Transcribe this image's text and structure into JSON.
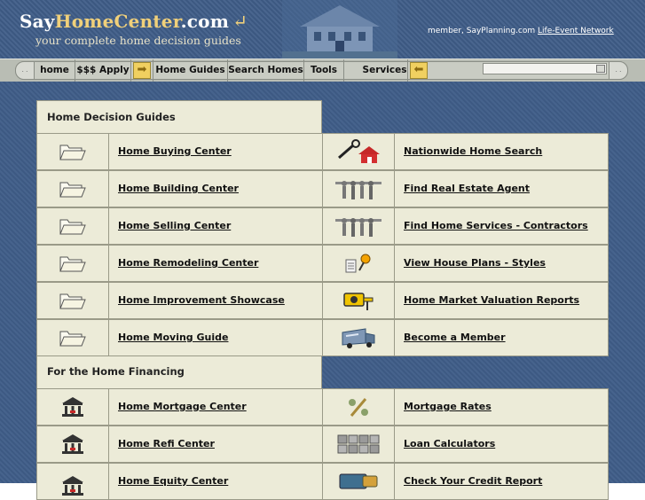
{
  "header": {
    "logo_say": "Say",
    "logo_home": "HomeCenter",
    "logo_com": ".com",
    "logo_arrow": "↵",
    "tagline": "your complete home decision guides",
    "member_prefix": "member, SayPlanning.com",
    "member_link": "Life-Event Network"
  },
  "nav": {
    "items": [
      "home",
      "$$$ Apply",
      "Home Guides",
      "Search Homes",
      "Tools",
      "Services"
    ],
    "arrow_right": "➡",
    "arrow_left": "⬅",
    "left_cap": ". .",
    "right_cap": ". ."
  },
  "sections": {
    "decision_title": "Home Decision Guides",
    "financing_title": "For the Home Financing"
  },
  "decision_rows": [
    {
      "left": "Home Buying Center",
      "right": "Nationwide Home Search",
      "left_icon": "folder-icon",
      "right_icon": "house-key-icon"
    },
    {
      "left": "Home Building Center",
      "right": "Find Real Estate Agent",
      "left_icon": "folder-icon",
      "right_icon": "people-icon"
    },
    {
      "left": "Home Selling Center",
      "right": "Find Home Services - Contractors",
      "left_icon": "folder-icon",
      "right_icon": "people-icon"
    },
    {
      "left": "Home Remodeling Center",
      "right": "View House Plans - Styles",
      "left_icon": "folder-icon",
      "right_icon": "plans-pin-icon"
    },
    {
      "left": "Home Improvement Showcase",
      "right": "Home Market Valuation Reports",
      "left_icon": "folder-icon",
      "right_icon": "measure-tape-icon"
    },
    {
      "left": "Home Moving Guide",
      "right": "Become a Member",
      "left_icon": "folder-icon",
      "right_icon": "moving-truck-icon"
    }
  ],
  "financing_rows": [
    {
      "left": "Home Mortgage Center",
      "right": "Mortgage Rates",
      "left_icon": "bank-icon",
      "right_icon": "percent-icon"
    },
    {
      "left": "Home Refi Center",
      "right": "Loan Calculators",
      "left_icon": "bank-icon",
      "right_icon": "calculator-icon"
    },
    {
      "left": "Home Equity Center",
      "right": "Check Your Credit Report",
      "left_icon": "bank-icon",
      "right_icon": "credit-card-icon"
    }
  ]
}
